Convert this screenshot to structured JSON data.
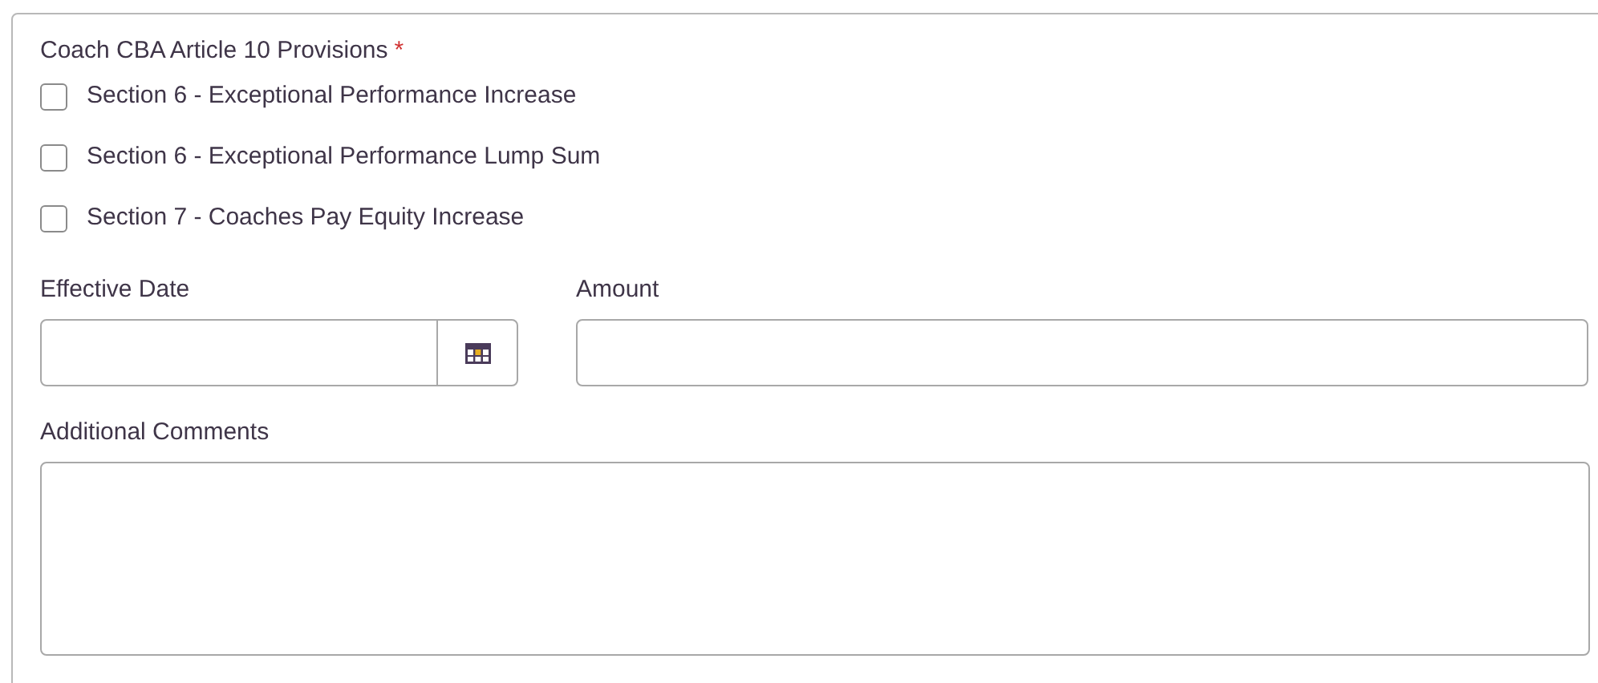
{
  "group_label": "Coach CBA Article 10 Provisions",
  "required_mark": "*",
  "options": [
    {
      "label": "Section 6 - Exceptional Performance Increase",
      "checked": false
    },
    {
      "label": "Section 6 - Exceptional Performance Lump Sum",
      "checked": false
    },
    {
      "label": "Section 7 - Coaches Pay Equity Increase",
      "checked": false
    }
  ],
  "effective_date": {
    "label": "Effective Date"
  },
  "amount": {
    "label": "Amount"
  },
  "comments": {
    "label": "Additional Comments"
  }
}
